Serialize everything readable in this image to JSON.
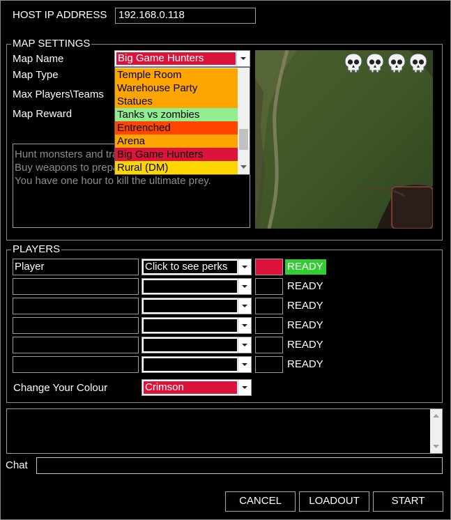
{
  "host": {
    "label": "HOST IP ADDRESS",
    "value": "192.168.0.118"
  },
  "map_settings": {
    "legend": "MAP SETTINGS",
    "labels": {
      "name": "Map Name",
      "type": "Map Type",
      "players": "Max Players\\Teams",
      "reward": "Map Reward"
    },
    "selected_map": "Big Game Hunters",
    "selected_color": "#dc143c",
    "dropdown_items": [
      {
        "label": "Temple Room",
        "color": "#ffa500"
      },
      {
        "label": "Warehouse Party",
        "color": "#ffa500"
      },
      {
        "label": "Statues",
        "color": "#ffa500"
      },
      {
        "label": "Tanks vs zombies",
        "color": "#90ee90"
      },
      {
        "label": "Entrenched",
        "color": "#ff4500"
      },
      {
        "label": "Arena",
        "color": "#ffa500"
      },
      {
        "label": "Big Game Hunters",
        "color": "#dc143c"
      },
      {
        "label": "Rural (DM)",
        "color": "#ffd700"
      }
    ],
    "description_lines": [
      "Hunt monsters and tra",
      "Buy weapons to prepa",
      "You have one hour to kill the ultimate prey."
    ],
    "preview_icons": [
      "skull-icon",
      "skull-icon",
      "skull-icon",
      "skull-icon"
    ]
  },
  "players": {
    "legend": "PLAYERS",
    "rows": [
      {
        "name": "Player",
        "perks": "Click to see perks",
        "color": "#dc143c",
        "ready": "READY",
        "ready_active": true
      },
      {
        "name": "",
        "perks": "",
        "color": "",
        "ready": "READY",
        "ready_active": false
      },
      {
        "name": "",
        "perks": "",
        "color": "",
        "ready": "READY",
        "ready_active": false
      },
      {
        "name": "",
        "perks": "",
        "color": "",
        "ready": "READY",
        "ready_active": false
      },
      {
        "name": "",
        "perks": "",
        "color": "",
        "ready": "READY",
        "ready_active": false
      },
      {
        "name": "",
        "perks": "",
        "color": "",
        "ready": "READY",
        "ready_active": false
      }
    ],
    "ready_color": "#32cd32",
    "colour_label": "Change Your Colour",
    "colour_value": "Crimson",
    "colour_hex": "#dc143c"
  },
  "chat": {
    "label": "Chat",
    "input": ""
  },
  "buttons": {
    "cancel": "CANCEL",
    "loadout": "LOADOUT",
    "start": "START"
  }
}
